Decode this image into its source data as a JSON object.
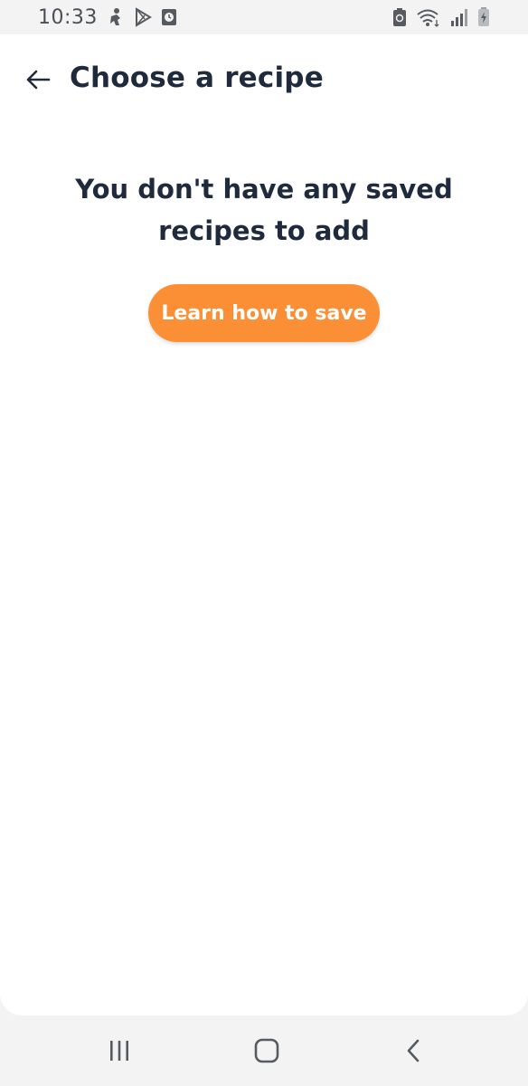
{
  "status_bar": {
    "time": "10:33",
    "left_icons": [
      "fitness-figure-icon",
      "play-store-icon",
      "clock-app-icon"
    ],
    "right_icons": [
      "battery-saver-icon",
      "wifi-icon",
      "signal-icon",
      "battery-icon"
    ]
  },
  "header": {
    "back_icon": "arrow-left-icon",
    "title": "Choose a recipe"
  },
  "main": {
    "empty_message": "You don't have any saved recipes to add",
    "learn_button_label": "Learn how to save"
  },
  "nav_bar": {
    "items": [
      "recent-apps-icon",
      "home-icon",
      "back-icon"
    ]
  },
  "colors": {
    "accent": "#fb8f35",
    "text_primary": "#1f2b3d",
    "background": "#ffffff",
    "system_bar": "#f3f3f3"
  }
}
